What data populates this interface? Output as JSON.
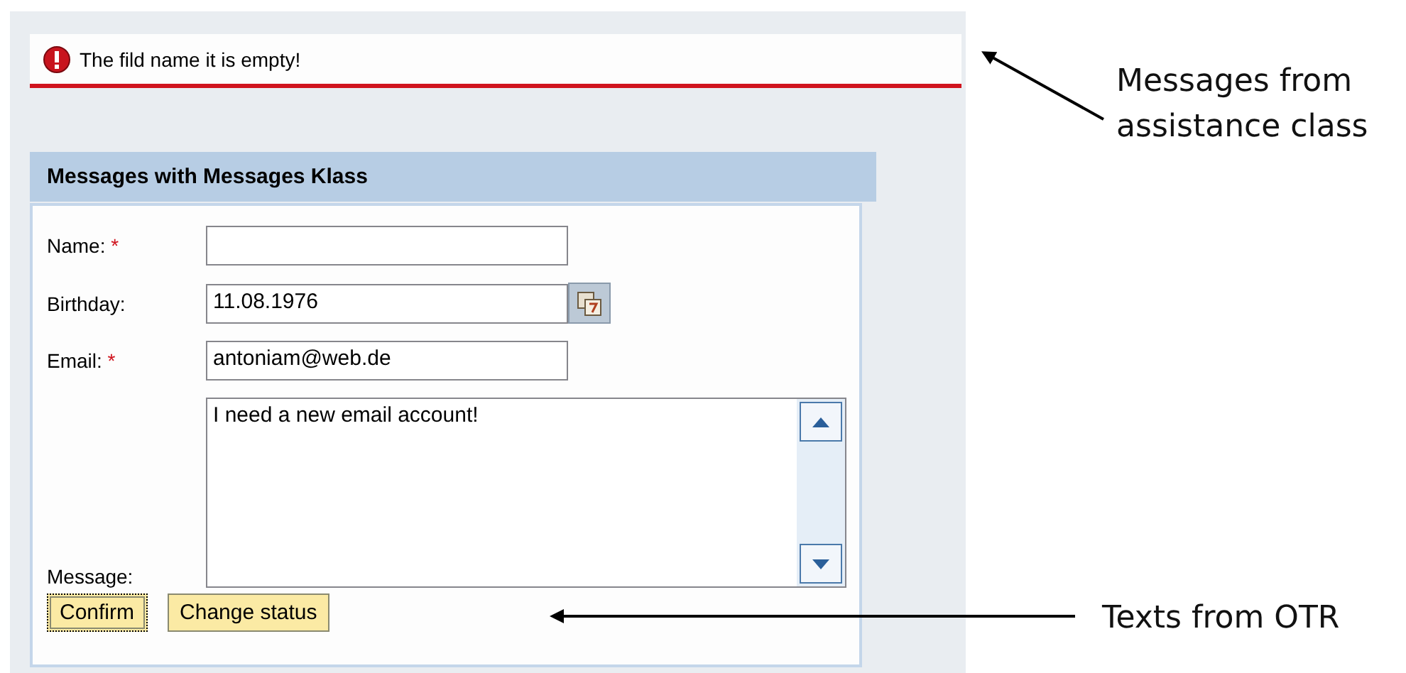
{
  "message_bar": {
    "kind": "error",
    "text": "The fild name it is empty!"
  },
  "panel": {
    "title": "Messages with Messages Klass",
    "fields": [
      {
        "kind": "text",
        "label": "Name:",
        "required_mark": "*"
      },
      {
        "kind": "date",
        "label": "Birthday:",
        "value": "11.08.1976"
      },
      {
        "kind": "text",
        "label": "Email:",
        "required_mark": "*",
        "value": "antoniam@web.de"
      },
      {
        "kind": "textarea",
        "label": "Message:",
        "value": "I need a new email account!"
      }
    ],
    "buttons": [
      {
        "label": "Confirm",
        "focused": true
      },
      {
        "label": "Change status",
        "focused": false
      }
    ]
  },
  "annotations": [
    {
      "lines": [
        "Messages from",
        "assistance class"
      ]
    },
    {
      "lines": [
        "Texts from OTR"
      ]
    }
  ]
}
